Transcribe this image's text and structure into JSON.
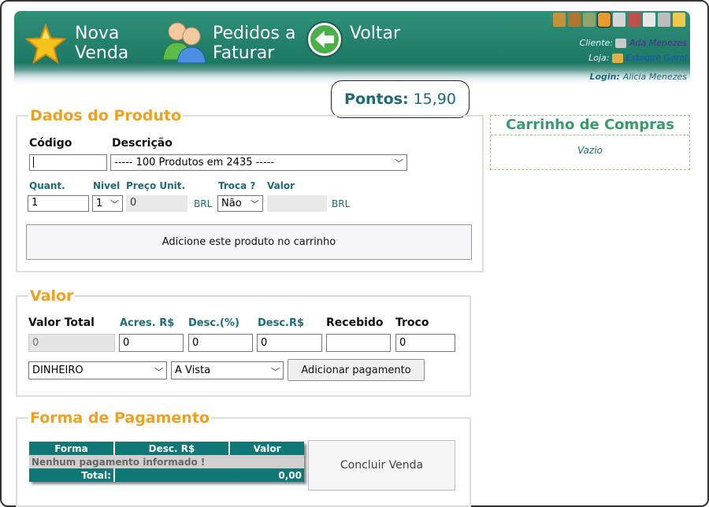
{
  "header": {
    "nova_venda": [
      "Nova",
      "Venda"
    ],
    "pedidos": [
      "Pedidos a",
      "Faturar"
    ],
    "voltar": "Voltar",
    "cliente_label": "Cliente:",
    "cliente_value": "Ada Menezes",
    "loja_label": "Loja:",
    "loja_value": "Estoque Geral",
    "login_label": "Login:",
    "login_value": "Alicia Menezes",
    "toolbar_icons": [
      "box-icon",
      "box-edit-icon",
      "truck-icon",
      "user-icon",
      "tag-icon",
      "cart-icon",
      "document-icon",
      "printer-icon",
      "lock-icon"
    ]
  },
  "pontos": {
    "label": "Pontos:",
    "value": "15,90"
  },
  "produto": {
    "legend": "Dados do Produto",
    "codigo_label": "Código",
    "codigo_value": "",
    "descricao_label": "Descrição",
    "descricao_value": "----- 100 Produtos em 2435 -----",
    "quant_label": "Quant.",
    "quant_value": "1",
    "nivel_label": "Nivel",
    "nivel_value": "1",
    "preco_label": "Preço Unit.",
    "preco_value": "0",
    "preco_unit": "BRL",
    "troca_label": "Troca ?",
    "troca_value": "Não",
    "valor_label": "Valor",
    "valor_value": "",
    "valor_unit": "BRL",
    "add_button": "Adicione este produto no carrinho"
  },
  "cart": {
    "title": "Carrinho de Compras",
    "empty": "Vazio"
  },
  "valor": {
    "legend": "Valor",
    "total_label": "Valor Total",
    "total_value": "0",
    "acres_label": "Acres. R$",
    "acres_value": "0",
    "descp_label": "Desc.(%)",
    "descp_value": "0",
    "descr_label": "Desc.R$",
    "descr_value": "0",
    "recebido_label": "Recebido",
    "recebido_value": "",
    "troco_label": "Troco",
    "troco_value": "0",
    "metodo_value": "DINHEIRO",
    "prazo_value": "A Vista",
    "add_pagamento": "Adicionar pagamento"
  },
  "forma": {
    "legend": "Forma de Pagamento",
    "col_forma": "Forma",
    "col_desc": "Desc. R$",
    "col_valor": "Valor",
    "empty_row": "Nenhum pagamento informado !",
    "total_label": "Total:",
    "total_value": "0,00",
    "concluir": "Concluir Venda"
  }
}
